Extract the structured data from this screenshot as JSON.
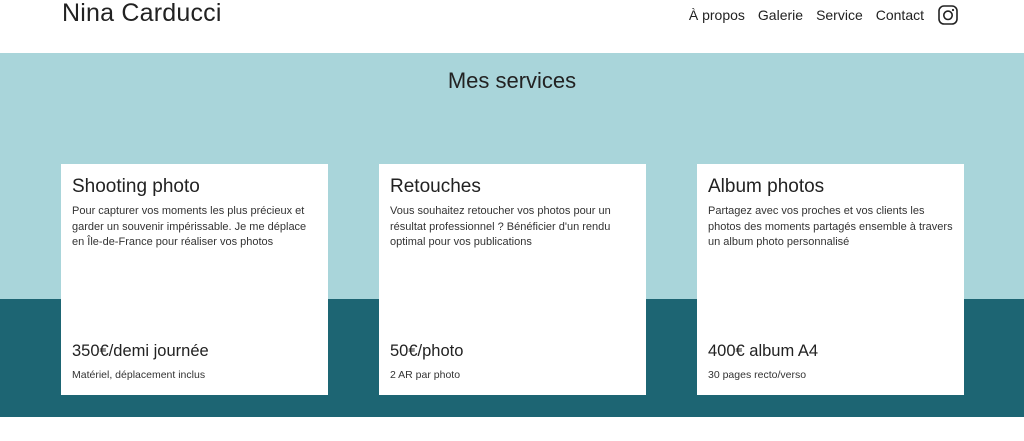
{
  "header": {
    "brand": "Nina Carducci",
    "nav": {
      "about": "À propos",
      "gallery": "Galerie",
      "service": "Service",
      "contact": "Contact"
    },
    "social_icon": "instagram-icon"
  },
  "services": {
    "title": "Mes services",
    "cards": [
      {
        "title": "Shooting photo",
        "description": "Pour capturer vos moments les plus précieux et garder un souvenir impérissable. Je me déplace en Île-de-France pour réaliser vos photos",
        "price": "350€/demi journée",
        "note": "Matériel, déplacement inclus"
      },
      {
        "title": "Retouches",
        "description": "Vous souhaitez retoucher vos photos pour un résultat professionnel ? Bénéficier d'un rendu optimal pour vos publications",
        "price": "50€/photo",
        "note": "2 AR par photo"
      },
      {
        "title": "Album photos",
        "description": "Partagez avec vos proches et vos clients les photos des moments partagés ensemble à travers un album photo personnalisé",
        "price": "400€ album A4",
        "note": "30 pages recto/verso"
      }
    ]
  },
  "colors": {
    "light_band": "#a9d5da",
    "dark_band": "#1d6573",
    "card_bg": "#ffffff",
    "text": "#222222"
  }
}
